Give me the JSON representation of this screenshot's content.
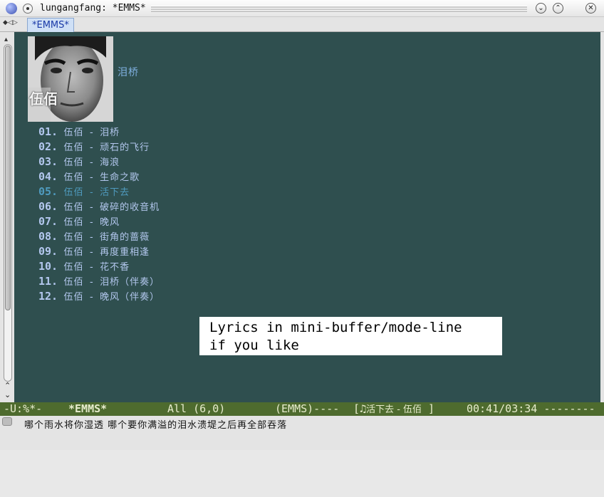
{
  "window": {
    "title": "lungangfang: *EMMS*",
    "minimize_glyph": "⌄",
    "maximize_glyph": "⌃",
    "close_glyph": "✕"
  },
  "tabbar": {
    "arrows": "◆◁▷",
    "tab_label": "*EMMS*"
  },
  "scrollbar": {
    "up_glyph": "▴",
    "arrow_up_glyph": "⌃",
    "arrow_down_glyph": "⌄"
  },
  "album": {
    "title": "泪桥",
    "cover_text": "伍佰"
  },
  "playlist": [
    {
      "num": "01.",
      "artist": "伍佰",
      "song": "泪桥"
    },
    {
      "num": "02.",
      "artist": "伍佰",
      "song": "顽石的飞行"
    },
    {
      "num": "03.",
      "artist": "伍佰",
      "song": "海浪"
    },
    {
      "num": "04.",
      "artist": "伍佰",
      "song": "生命之歌"
    },
    {
      "num": "05.",
      "artist": "伍佰",
      "song": "活下去",
      "current": true
    },
    {
      "num": "06.",
      "artist": "伍佰",
      "song": "破碎的收音机"
    },
    {
      "num": "07.",
      "artist": "伍佰",
      "song": "晚风"
    },
    {
      "num": "08.",
      "artist": "伍佰",
      "song": "街角的蔷薇"
    },
    {
      "num": "09.",
      "artist": "伍佰",
      "song": "再度重相逢"
    },
    {
      "num": "10.",
      "artist": "伍佰",
      "song": "花不香"
    },
    {
      "num": "11.",
      "artist": "伍佰",
      "song": "泪桥（伴奏）"
    },
    {
      "num": "12.",
      "artist": "伍佰",
      "song": "晚风（伴奏）"
    }
  ],
  "separator": "-",
  "annotation": {
    "line1": "Lyrics in mini-buffer/mode-line",
    "line2": "if you like"
  },
  "modeline": {
    "status": "-U:%*-",
    "buffer_name": "*EMMS*",
    "position": "All (6,0)",
    "mode": "(EMMS)----",
    "song_open": "[♫",
    "song_title": "活下去 - 伍佰",
    "song_close": " ]",
    "time": "00:41/03:34 --------"
  },
  "minibuffer": {
    "lyric": "哪个雨水将你湿透 哪个要你满溢的泪水溃堤之后再全部吞落"
  },
  "colors": {
    "buffer_bg": "#2f4f4f",
    "track_text": "#b3c7ee",
    "current_track": "#4f9bbf",
    "modeline_bg": "#4e6b2e",
    "album_title": "#7fb0e0"
  }
}
